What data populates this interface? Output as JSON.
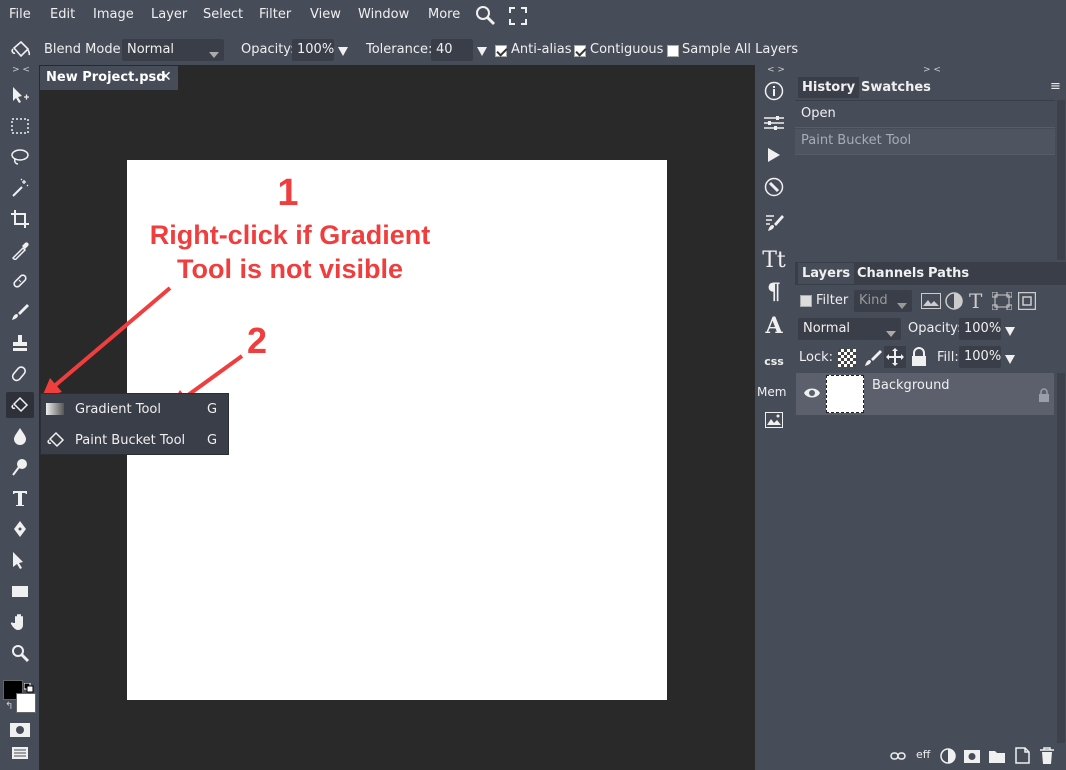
{
  "menu": [
    "File",
    "Edit",
    "Image",
    "Layer",
    "Select",
    "Filter",
    "View",
    "Window",
    "More"
  ],
  "options": {
    "blend_label": "Blend Mode:",
    "blend_value": "Normal",
    "opacity_label": "Opacity:",
    "opacity_value": "100%",
    "tolerance_label": "Tolerance:",
    "tolerance_value": "40",
    "antialias_label": "Anti-alias",
    "contiguous_label": "Contiguous",
    "sample_label": "Sample All Layers"
  },
  "doc_tab": {
    "title": "New Project.psd",
    "close": "✕"
  },
  "collapse": {
    "left": "> <",
    "mid": "< >",
    "right": "> <"
  },
  "popup": {
    "items": [
      {
        "label": "Gradient Tool",
        "shortcut": "G"
      },
      {
        "label": "Paint Bucket Tool",
        "shortcut": "G"
      }
    ]
  },
  "annotations": {
    "one": "1",
    "one_text_1": "Right-click if Gradient",
    "one_text_2": "Tool is not visible",
    "two": "2"
  },
  "mid_panel": {
    "css": "css",
    "mem": "Mem"
  },
  "history": {
    "tabs": [
      "History",
      "Swatches"
    ],
    "menu": "≡",
    "items": [
      "Open",
      "Paint Bucket Tool"
    ]
  },
  "layers": {
    "tabs": [
      "Layers",
      "Channels",
      "Paths"
    ],
    "filter_label": "Filter",
    "kind_value": "Kind",
    "blend_value": "Normal",
    "opacity_label": "Opacity:",
    "opacity_value": "100%",
    "lock_label": "Lock:",
    "fill_label": "Fill:",
    "fill_value": "100%",
    "layer_name": "Background",
    "footer_eff": "eff"
  },
  "colors": {
    "bg": "#474c59",
    "workspace": "#292929",
    "accent": "#f03e3e"
  }
}
